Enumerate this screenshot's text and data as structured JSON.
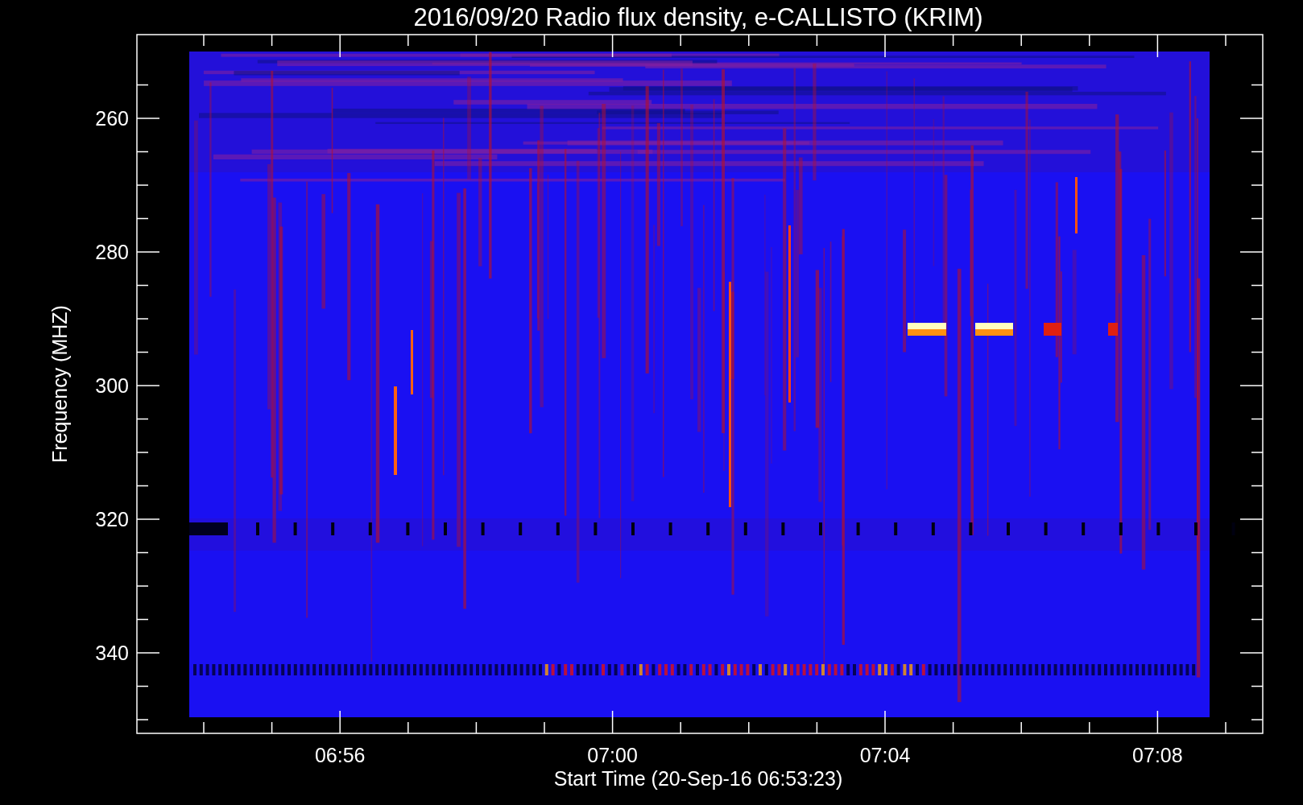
{
  "title": "2016/09/20  Radio flux density, e-CALLISTO (KRIM)",
  "y_axis": {
    "label": "Frequency (MHZ)",
    "ticks": [
      {
        "label": "260"
      },
      {
        "label": "280"
      },
      {
        "label": "300"
      },
      {
        "label": "320"
      },
      {
        "label": "340"
      }
    ]
  },
  "x_axis": {
    "label": "Start Time (20-Sep-16 06:53:23)",
    "ticks": [
      {
        "label": "06:56"
      },
      {
        "label": "07:00"
      },
      {
        "label": "07:04"
      },
      {
        "label": "07:08"
      }
    ]
  }
}
